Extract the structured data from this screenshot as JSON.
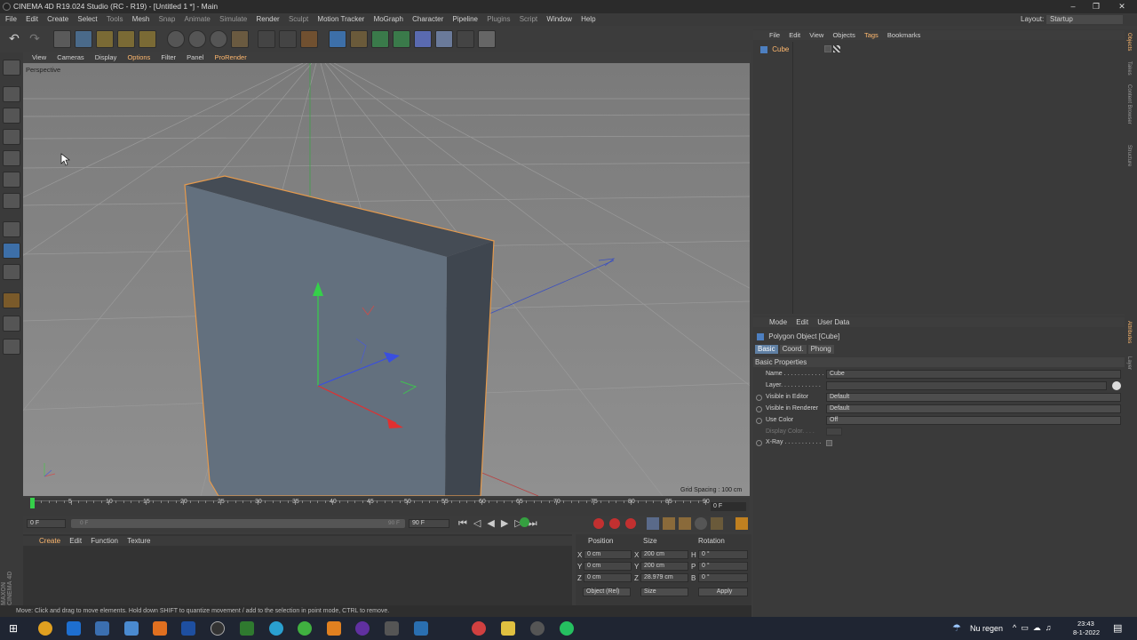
{
  "titlebar": {
    "title": "CINEMA 4D R19.024 Studio (RC - R19) - [Untitled 1 *] - Main",
    "minimize": "–",
    "restore": "❐",
    "close": "✕"
  },
  "menubar": {
    "items": [
      "File",
      "Edit",
      "Create",
      "Select",
      "Tools",
      "Mesh",
      "Snap",
      "Animate",
      "Simulate",
      "Render",
      "Sculpt",
      "Motion Tracker",
      "MoGraph",
      "Character",
      "Pipeline",
      "Plugins",
      "Script",
      "Window",
      "Help"
    ],
    "layout_label": "Layout:",
    "layout_value": "Startup"
  },
  "viewport": {
    "menu": [
      "View",
      "Cameras",
      "Display",
      "Options",
      "Filter",
      "Panel",
      "ProRender"
    ],
    "name": "Perspective",
    "grid_spacing": "Grid Spacing : 100 cm"
  },
  "timeline": {
    "ticks": [
      "0",
      "5",
      "10",
      "15",
      "20",
      "25",
      "30",
      "35",
      "40",
      "45",
      "50",
      "55",
      "60",
      "65",
      "70",
      "75",
      "80",
      "85",
      "90"
    ],
    "current_frame": "0 F"
  },
  "playbar": {
    "start_frame": "0 F",
    "range_start": "0 F",
    "range_end": "90 F",
    "end_frame": "90 F"
  },
  "material_manager": {
    "menu": [
      "Create",
      "Edit",
      "Function",
      "Texture"
    ]
  },
  "coordinates": {
    "headers": [
      "Position",
      "Size",
      "Rotation"
    ],
    "rows": [
      {
        "pos_label": "X",
        "pos": "0 cm",
        "size_label": "X",
        "size": "200 cm",
        "rot_label": "H",
        "rot": "0 °"
      },
      {
        "pos_label": "Y",
        "pos": "0 cm",
        "size_label": "Y",
        "size": "200 cm",
        "rot_label": "P",
        "rot": "0 °"
      },
      {
        "pos_label": "Z",
        "pos": "0 cm",
        "size_label": "Z",
        "size": "28.979 cm",
        "rot_label": "B",
        "rot": "0 °"
      }
    ],
    "mode": "Object (Rel)",
    "size_mode": "Size",
    "apply": "Apply"
  },
  "status": "Move: Click and drag to move elements. Hold down SHIFT to quantize movement / add to the selection in point mode, CTRL to remove.",
  "object_manager": {
    "menu": [
      "File",
      "Edit",
      "View",
      "Objects",
      "Tags",
      "Bookmarks"
    ],
    "objects": [
      {
        "name": "Cube"
      }
    ]
  },
  "attribute_manager": {
    "menu": [
      "Mode",
      "Edit",
      "User Data"
    ],
    "object_title": "Polygon Object [Cube]",
    "tabs": [
      "Basic",
      "Coord.",
      "Phong"
    ],
    "section": "Basic Properties",
    "fields": [
      {
        "label": "Name . . . . . . . . . . . .",
        "value": "Cube"
      },
      {
        "label": "Layer. . . . . . . . . . . .",
        "value": ""
      },
      {
        "label": "Visible in Editor",
        "value": "Default"
      },
      {
        "label": "Visible in Renderer",
        "value": "Default"
      },
      {
        "label": "Use Color",
        "value": "Off"
      },
      {
        "label": "Display Color. . . . ",
        "value": ""
      },
      {
        "label": "X-Ray . . . . . . . . . . .",
        "value": ""
      }
    ]
  },
  "right_tabs": [
    "Objects",
    "Takes",
    "Content Browser",
    "Structure"
  ],
  "right_tabs_bottom": [
    "Attributes",
    "Layer"
  ],
  "brand": {
    "maxon": "MAXON",
    "product": "CINEMA 4D"
  },
  "taskbar": {
    "weather": "Nu regen",
    "time": "23:43",
    "date": "8-1-2022"
  },
  "colors": {
    "accent_orange": "#ffb86e",
    "selection_blue": "#5f7fa3",
    "cube_face": "#63707e",
    "cube_outline": "#e59a4d"
  }
}
